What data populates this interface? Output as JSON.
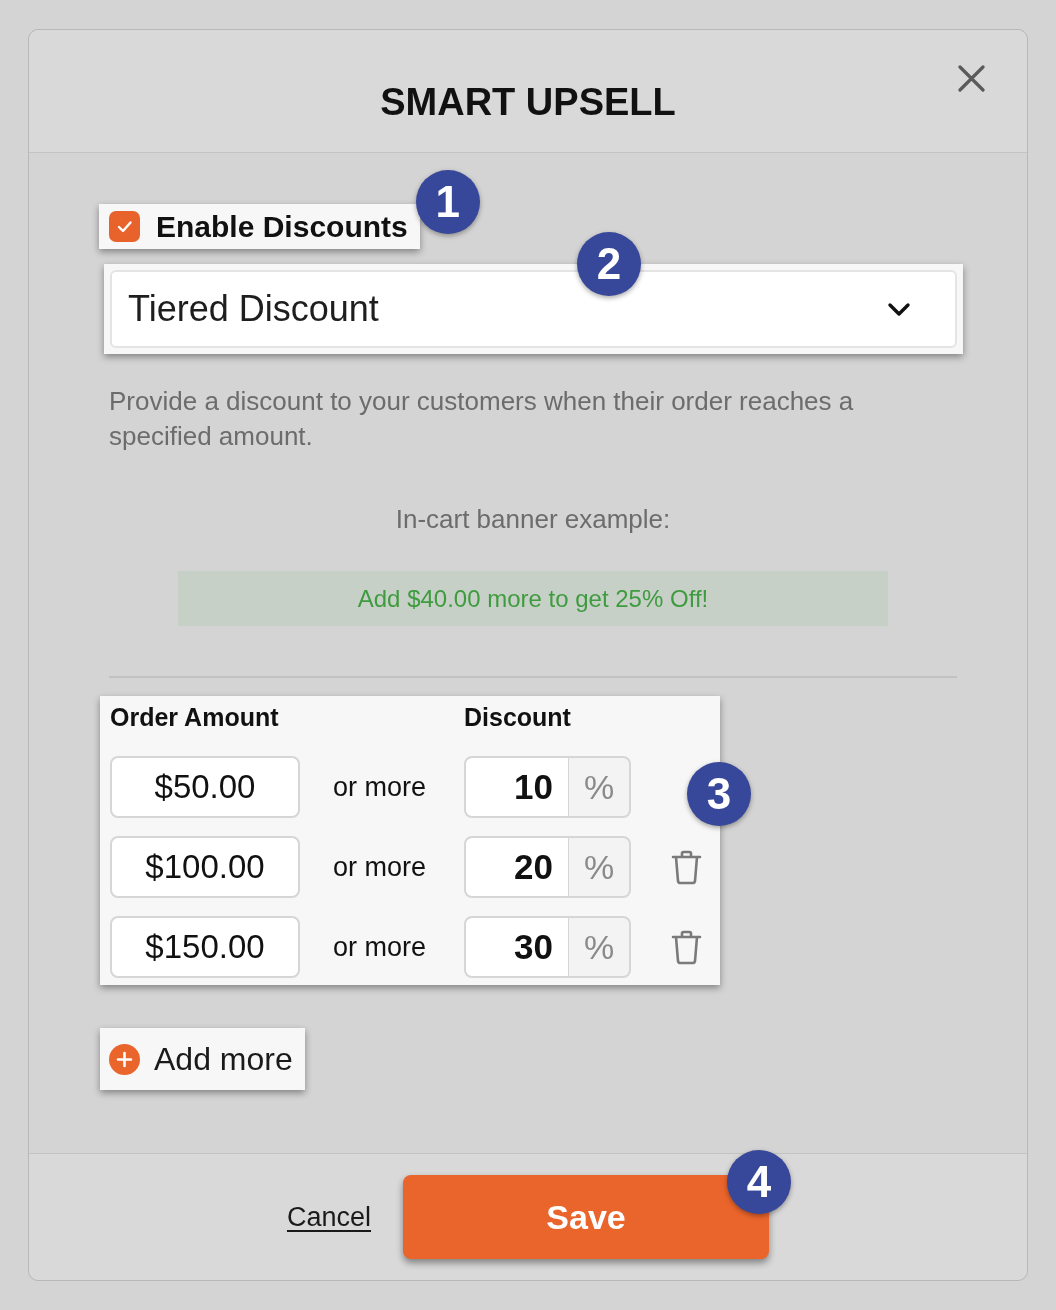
{
  "dialog": {
    "title": "SMART UPSELL"
  },
  "enable_discounts": {
    "label": "Enable Discounts",
    "checked": true,
    "callout": "1"
  },
  "discount_type": {
    "value": "Tiered Discount",
    "callout": "2"
  },
  "description": "Provide a discount to your customers when their order reaches a specified amount.",
  "banner_example": {
    "label": "In-cart banner example:",
    "text": "Add $40.00 more to get 25% Off!"
  },
  "tiers": {
    "callout": "3",
    "columns": [
      "Order Amount",
      "Discount"
    ],
    "rows": [
      {
        "amount": "$50.00",
        "connector": "or more",
        "discount": "10",
        "unit": "%",
        "deletable": false
      },
      {
        "amount": "$100.00",
        "connector": "or more",
        "discount": "20",
        "unit": "%",
        "deletable": true
      },
      {
        "amount": "$150.00",
        "connector": "or more",
        "discount": "30",
        "unit": "%",
        "deletable": true
      }
    ]
  },
  "add_button": "Add more",
  "footer": {
    "cancel": "Cancel",
    "save": "Save",
    "save_callout": "4"
  }
}
